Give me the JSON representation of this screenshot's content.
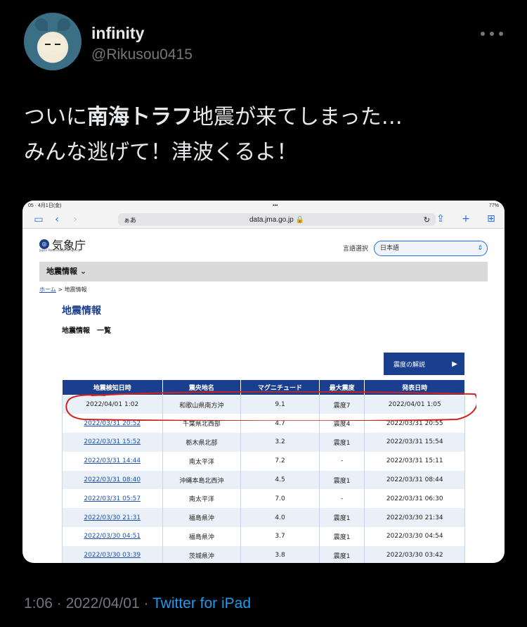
{
  "author": {
    "display_name": "infinity",
    "handle": "@Rikusou0415"
  },
  "tweet": {
    "line1_pre": "ついに",
    "line1_bold": "南海トラフ",
    "line1_post": "地震が来てしまった…",
    "line2": "みんな逃げて！津波くるよ！"
  },
  "meta": {
    "time": "1:06",
    "date": "2022/04/01",
    "separator": "·",
    "source": "Twitter for iPad"
  },
  "screenshot": {
    "status_left": "05 · 4月1日(金)",
    "status_right": "77%",
    "url": "data.jma.go.jp",
    "aa": "ぁあ",
    "agency_name": "気象庁",
    "agency_sub": "Japan Meteorological Agency",
    "lang_label": "言語選択",
    "lang_value": "日本語",
    "menu": "地震情報",
    "breadcrumb_home": "ホーム",
    "breadcrumb_sep": ">",
    "breadcrumb_current": "地震情報",
    "page_title": "地震情報",
    "sub_title": "地震情報　一覧",
    "explain_button": "震度の解説",
    "columns": [
      "地震検知日時",
      "震央地名",
      "マグニチュード",
      "最大震度",
      "発表日時"
    ],
    "rows": [
      [
        "2022/04/01 1:02",
        "和歌山県南方沖",
        "9.1",
        "震度7",
        "2022/04/01 1:05"
      ],
      [
        "2022/03/31 20:52",
        "千葉県北西部",
        "4.7",
        "震度4",
        "2022/03/31 20:55"
      ],
      [
        "2022/03/31 15:52",
        "栃木県北部",
        "3.2",
        "震度1",
        "2022/03/31 15:54"
      ],
      [
        "2022/03/31 14:44",
        "南太平洋",
        "7.2",
        "-",
        "2022/03/31 15:11"
      ],
      [
        "2022/03/31 08:40",
        "沖縄本島北西沖",
        "4.5",
        "震度1",
        "2022/03/31 08:44"
      ],
      [
        "2022/03/31 05:57",
        "南太平洋",
        "7.0",
        "-",
        "2022/03/31 06:30"
      ],
      [
        "2022/03/30 21:31",
        "福島県沖",
        "4.0",
        "震度1",
        "2022/03/30 21:34"
      ],
      [
        "2022/03/30 04:51",
        "福島県沖",
        "3.7",
        "震度1",
        "2022/03/30 04:54"
      ],
      [
        "2022/03/30 03:39",
        "茨城県沖",
        "3.8",
        "震度1",
        "2022/03/30 03:42"
      ]
    ]
  },
  "colors": {
    "background": "#000000",
    "handle": "#71767b",
    "source_link": "#1d9bf0",
    "jma_blue": "#1b3f8f",
    "circle": "#d22020"
  }
}
